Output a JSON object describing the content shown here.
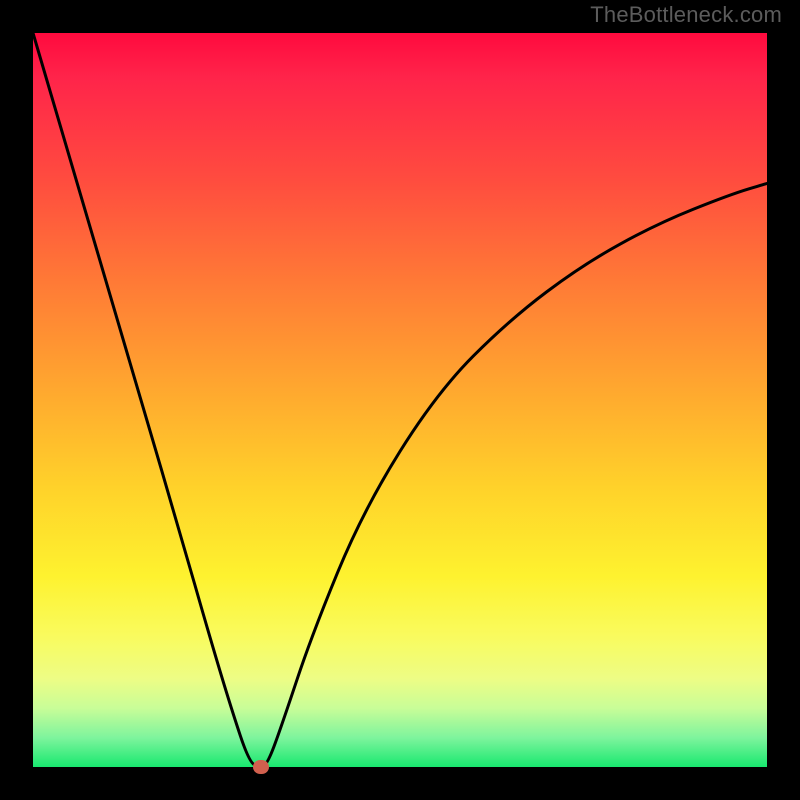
{
  "watermark": "TheBottleneck.com",
  "chart_data": {
    "type": "line",
    "title": "",
    "xlabel": "",
    "ylabel": "",
    "xlim": [
      0,
      100
    ],
    "ylim": [
      0,
      100
    ],
    "grid": false,
    "legend": false,
    "series": [
      {
        "name": "bottleneck-curve",
        "x": [
          0,
          5,
          10,
          15,
          20,
          24,
          27,
          29.5,
          31,
          32,
          34,
          38,
          45,
          55,
          65,
          75,
          85,
          95,
          100
        ],
        "values": [
          100,
          83,
          66,
          49,
          32,
          18,
          8,
          0.5,
          0,
          0.5,
          6,
          18,
          35,
          51,
          61,
          68.5,
          74,
          78,
          79.5
        ]
      }
    ],
    "marker": {
      "x": 31,
      "y": 0,
      "color": "#d1604e"
    },
    "gradient_stops": [
      {
        "pos": 0,
        "color": "#ff0a3e"
      },
      {
        "pos": 6,
        "color": "#ff244a"
      },
      {
        "pos": 20,
        "color": "#ff4c3f"
      },
      {
        "pos": 34,
        "color": "#ff7a36"
      },
      {
        "pos": 48,
        "color": "#ffa62f"
      },
      {
        "pos": 62,
        "color": "#ffd22a"
      },
      {
        "pos": 74,
        "color": "#fef22f"
      },
      {
        "pos": 82,
        "color": "#f9fb5d"
      },
      {
        "pos": 88,
        "color": "#edfd85"
      },
      {
        "pos": 92,
        "color": "#c8fd98"
      },
      {
        "pos": 96,
        "color": "#7ef49d"
      },
      {
        "pos": 100,
        "color": "#18e86f"
      }
    ]
  }
}
